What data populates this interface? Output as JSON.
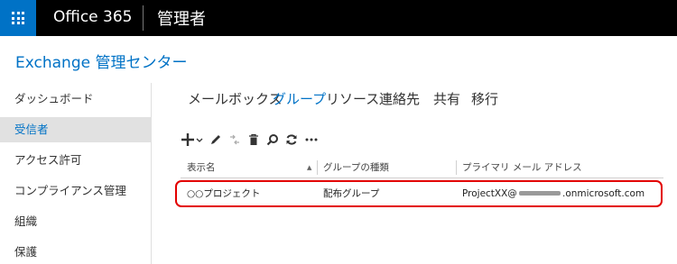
{
  "topbar": {
    "app_name": "Office 365",
    "section_title": "管理者",
    "waffle_icon": "app-launcher-icon",
    "brand_color": "#0072c6"
  },
  "header": {
    "title": "Exchange 管理センター"
  },
  "leftnav": {
    "items": [
      {
        "label": "ダッシュボード",
        "active": false
      },
      {
        "label": "受信者",
        "active": true
      },
      {
        "label": "アクセス許可",
        "active": false
      },
      {
        "label": "コンプライアンス管理",
        "active": false
      },
      {
        "label": "組織",
        "active": false
      },
      {
        "label": "保護",
        "active": false
      }
    ]
  },
  "tabs": [
    {
      "label": "メールボックス",
      "active": false
    },
    {
      "label": "グループ",
      "active": true
    },
    {
      "label": "リソース",
      "active": false
    },
    {
      "label": "連絡先",
      "active": false
    },
    {
      "label": "共有",
      "active": false
    },
    {
      "label": "移行",
      "active": false
    }
  ],
  "toolbar": {
    "icons": [
      "add-icon",
      "edit-icon",
      "move-icon",
      "delete-icon",
      "search-icon",
      "refresh-icon",
      "more-icon"
    ]
  },
  "table": {
    "columns": [
      "表示名",
      "グループの種類",
      "プライマリ メール アドレス"
    ],
    "sorted_column": "表示名",
    "rows": [
      {
        "display_name": "○○プロジェクト",
        "group_type": "配布グループ",
        "email_prefix": "ProjectXX@",
        "email_suffix": ".onmicrosoft.com"
      }
    ]
  },
  "highlight_color": "#e30000"
}
